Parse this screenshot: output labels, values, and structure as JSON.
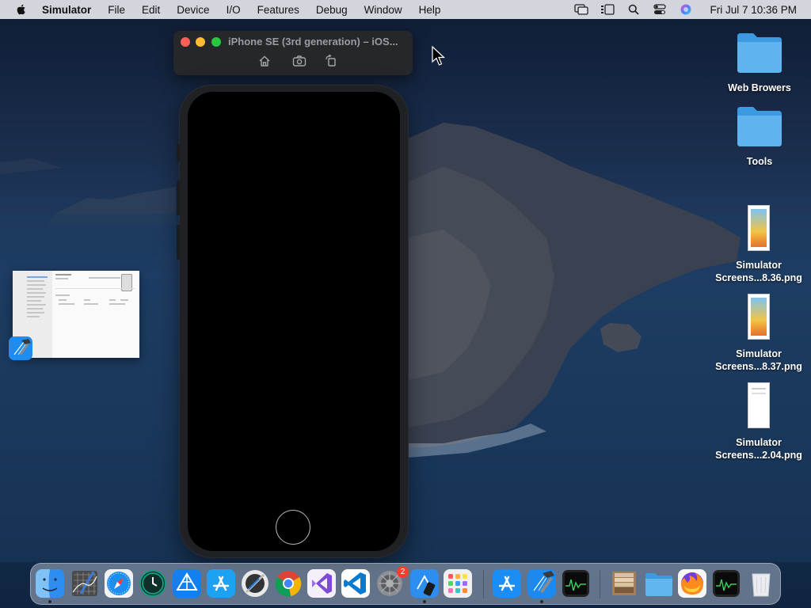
{
  "menubar": {
    "app_name": "Simulator",
    "items": [
      "File",
      "Edit",
      "Device",
      "I/O",
      "Features",
      "Debug",
      "Window",
      "Help"
    ],
    "clock": "Fri Jul 7  10:36 PM"
  },
  "simulator": {
    "window_title": "iPhone SE (3rd generation) – iOS..."
  },
  "desktop": {
    "items": [
      {
        "label": "Web Browers",
        "kind": "folder"
      },
      {
        "label": "Tools",
        "kind": "folder"
      },
      {
        "label": "Simulator Screens...8.36.png",
        "kind": "png"
      },
      {
        "label": "Simulator Screens...8.37.png",
        "kind": "png"
      },
      {
        "label": "Simulator Screens...2.04.png",
        "kind": "png"
      }
    ]
  },
  "dock": {
    "apps": [
      {
        "name": "finder-icon",
        "running": true
      },
      {
        "name": "grapher-icon",
        "running": false
      },
      {
        "name": "safari-icon",
        "running": false
      },
      {
        "name": "time-machine-icon",
        "running": false
      },
      {
        "name": "testflight-icon",
        "running": false
      },
      {
        "name": "app-store-icon",
        "running": false
      },
      {
        "name": "instruments-icon",
        "running": false
      },
      {
        "name": "chrome-icon",
        "running": false
      },
      {
        "name": "visual-studio-icon",
        "running": false
      },
      {
        "name": "vscode-icon",
        "running": false
      },
      {
        "name": "system-preferences-icon",
        "running": false,
        "badge": "2"
      },
      {
        "name": "simulator-icon",
        "running": true
      },
      {
        "name": "launchpad-icon",
        "running": false
      },
      {
        "name": "app-store-2-icon",
        "running": false
      },
      {
        "name": "xcode-icon",
        "running": true
      },
      {
        "name": "activity-monitor-icon",
        "running": false
      },
      {
        "name": "archive-utility-icon",
        "running": false
      },
      {
        "name": "folder-icon",
        "running": false
      },
      {
        "name": "firefox-icon",
        "running": false
      },
      {
        "name": "activity-monitor-2-icon",
        "running": false
      },
      {
        "name": "trash-icon",
        "running": false
      }
    ]
  }
}
